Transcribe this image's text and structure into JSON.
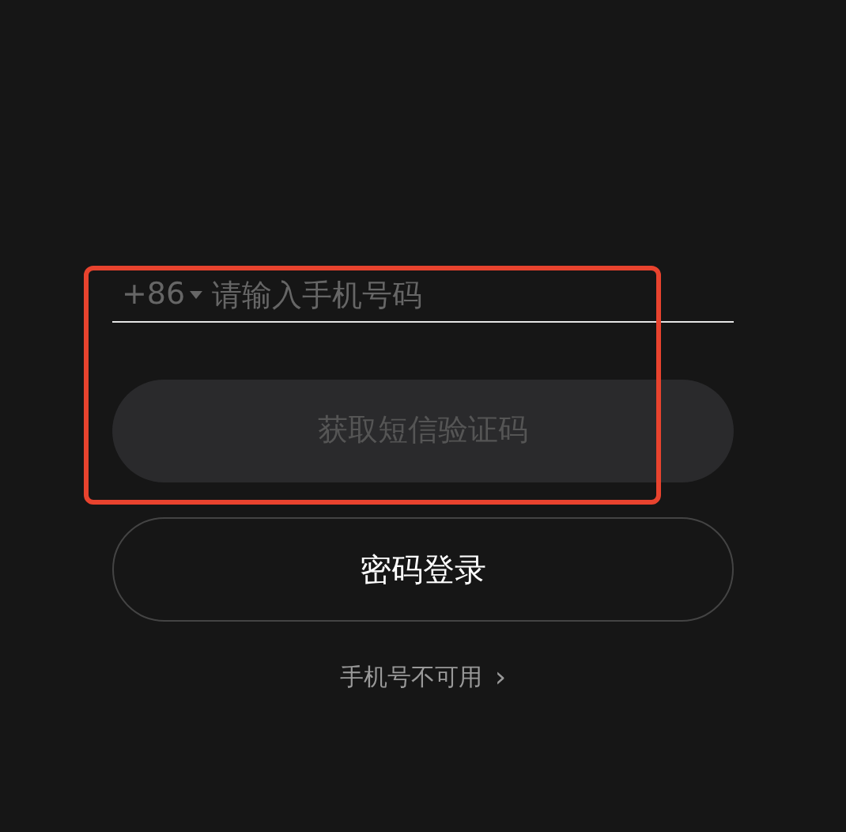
{
  "phone_field": {
    "country_code": "+86",
    "placeholder": "请输入手机号码"
  },
  "sms_button": {
    "label": "获取短信验证码",
    "disabled": true
  },
  "password_login_button": {
    "label": "密码登录"
  },
  "phone_unavailable_link": {
    "label": "手机号不可用",
    "arrow": "›"
  },
  "highlight": {
    "color": "#e8432e"
  }
}
